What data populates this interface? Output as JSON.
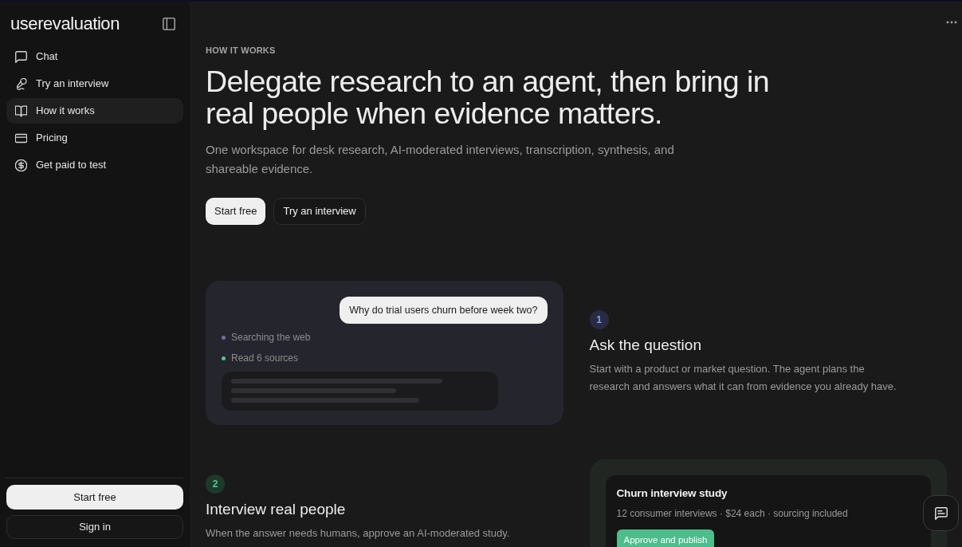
{
  "sidebar": {
    "logo": "userevaluation",
    "nav": [
      {
        "label": "Chat",
        "selected": false
      },
      {
        "label": "Try an interview",
        "selected": false
      },
      {
        "label": "How it works",
        "selected": true
      },
      {
        "label": "Pricing",
        "selected": false
      },
      {
        "label": "Get paid to test",
        "selected": false
      }
    ],
    "actions": [
      {
        "label": "Start free",
        "kind": "primary"
      },
      {
        "label": "Sign in",
        "kind": "secondary"
      }
    ]
  },
  "hero": {
    "eyebrow": "HOW IT WORKS",
    "title": "Delegate research to an agent, then bring in real people when evidence matters.",
    "subtitle": "One workspace for desk research, AI-moderated interviews, transcription, synthesis, and shareable evidence.",
    "actions": [
      {
        "label": "Start free",
        "kind": "primary"
      },
      {
        "label": "Try an interview",
        "kind": "secondary"
      }
    ]
  },
  "steps": [
    {
      "number": "1",
      "title": "Ask the question",
      "description": "Start with a product or market question. The agent plans the research and answers what it can from evidence you already have.",
      "kind": "chat",
      "preview": {
        "question": "Why do trial users churn before week two?",
        "activity": [
          {
            "label": "Searching the web",
            "color": "#6e70a8"
          },
          {
            "label": "Read 6 sources",
            "color": "#4fc795"
          }
        ]
      }
    },
    {
      "number": "2",
      "title": "Interview real people",
      "description": "When the answer needs humans, approve an AI-moderated study.",
      "kind": "study",
      "preview": {
        "title": "Churn interview study",
        "details": "12 consumer interviews · $24 each · sourcing included",
        "action": "Approve and publish"
      }
    }
  ]
}
